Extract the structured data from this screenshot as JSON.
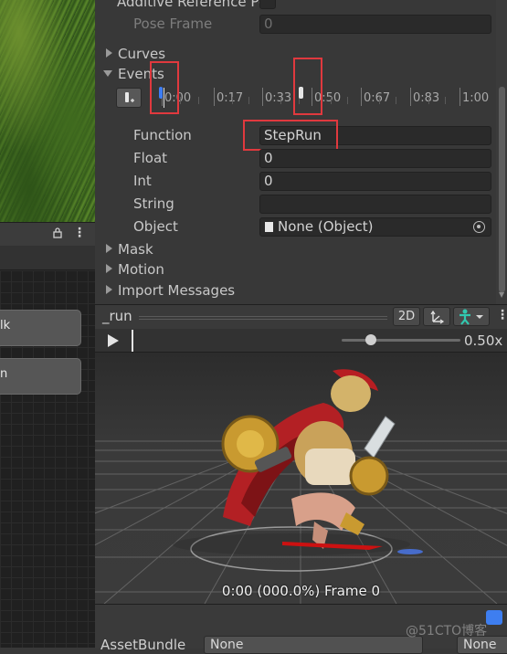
{
  "inspector": {
    "additive_reference_label": "Additive Reference Po",
    "pose_frame_label": "Pose Frame",
    "pose_frame_value": "0",
    "curves_label": "Curves",
    "events_label": "Events",
    "timeline_ticks": [
      "0:00",
      "0:17",
      "0:33",
      "0:50",
      "0:67",
      "0:83",
      "1:00"
    ],
    "function_label": "Function",
    "function_value": "StepRun",
    "float_label": "Float",
    "float_value": "0",
    "int_label": "Int",
    "int_value": "0",
    "string_label": "String",
    "string_value": "",
    "object_label": "Object",
    "object_value": "None (Object)",
    "mask_label": "Mask",
    "motion_label": "Motion",
    "import_messages_label": "Import Messages"
  },
  "left_pane": {
    "state_nodes": [
      "lk",
      "n"
    ]
  },
  "preview": {
    "title": "_run",
    "btn_2d": "2D",
    "speed": "0.50x",
    "frame_info": "0:00 (000.0%) Frame 0"
  },
  "bottom": {
    "asset_label": "AssetBundle",
    "asset_value": "None",
    "variant_value": "None"
  },
  "watermark": "@51CTO博客",
  "colors": {
    "highlight_box": "#e0393e",
    "selected_event": "#3d7ef5"
  }
}
